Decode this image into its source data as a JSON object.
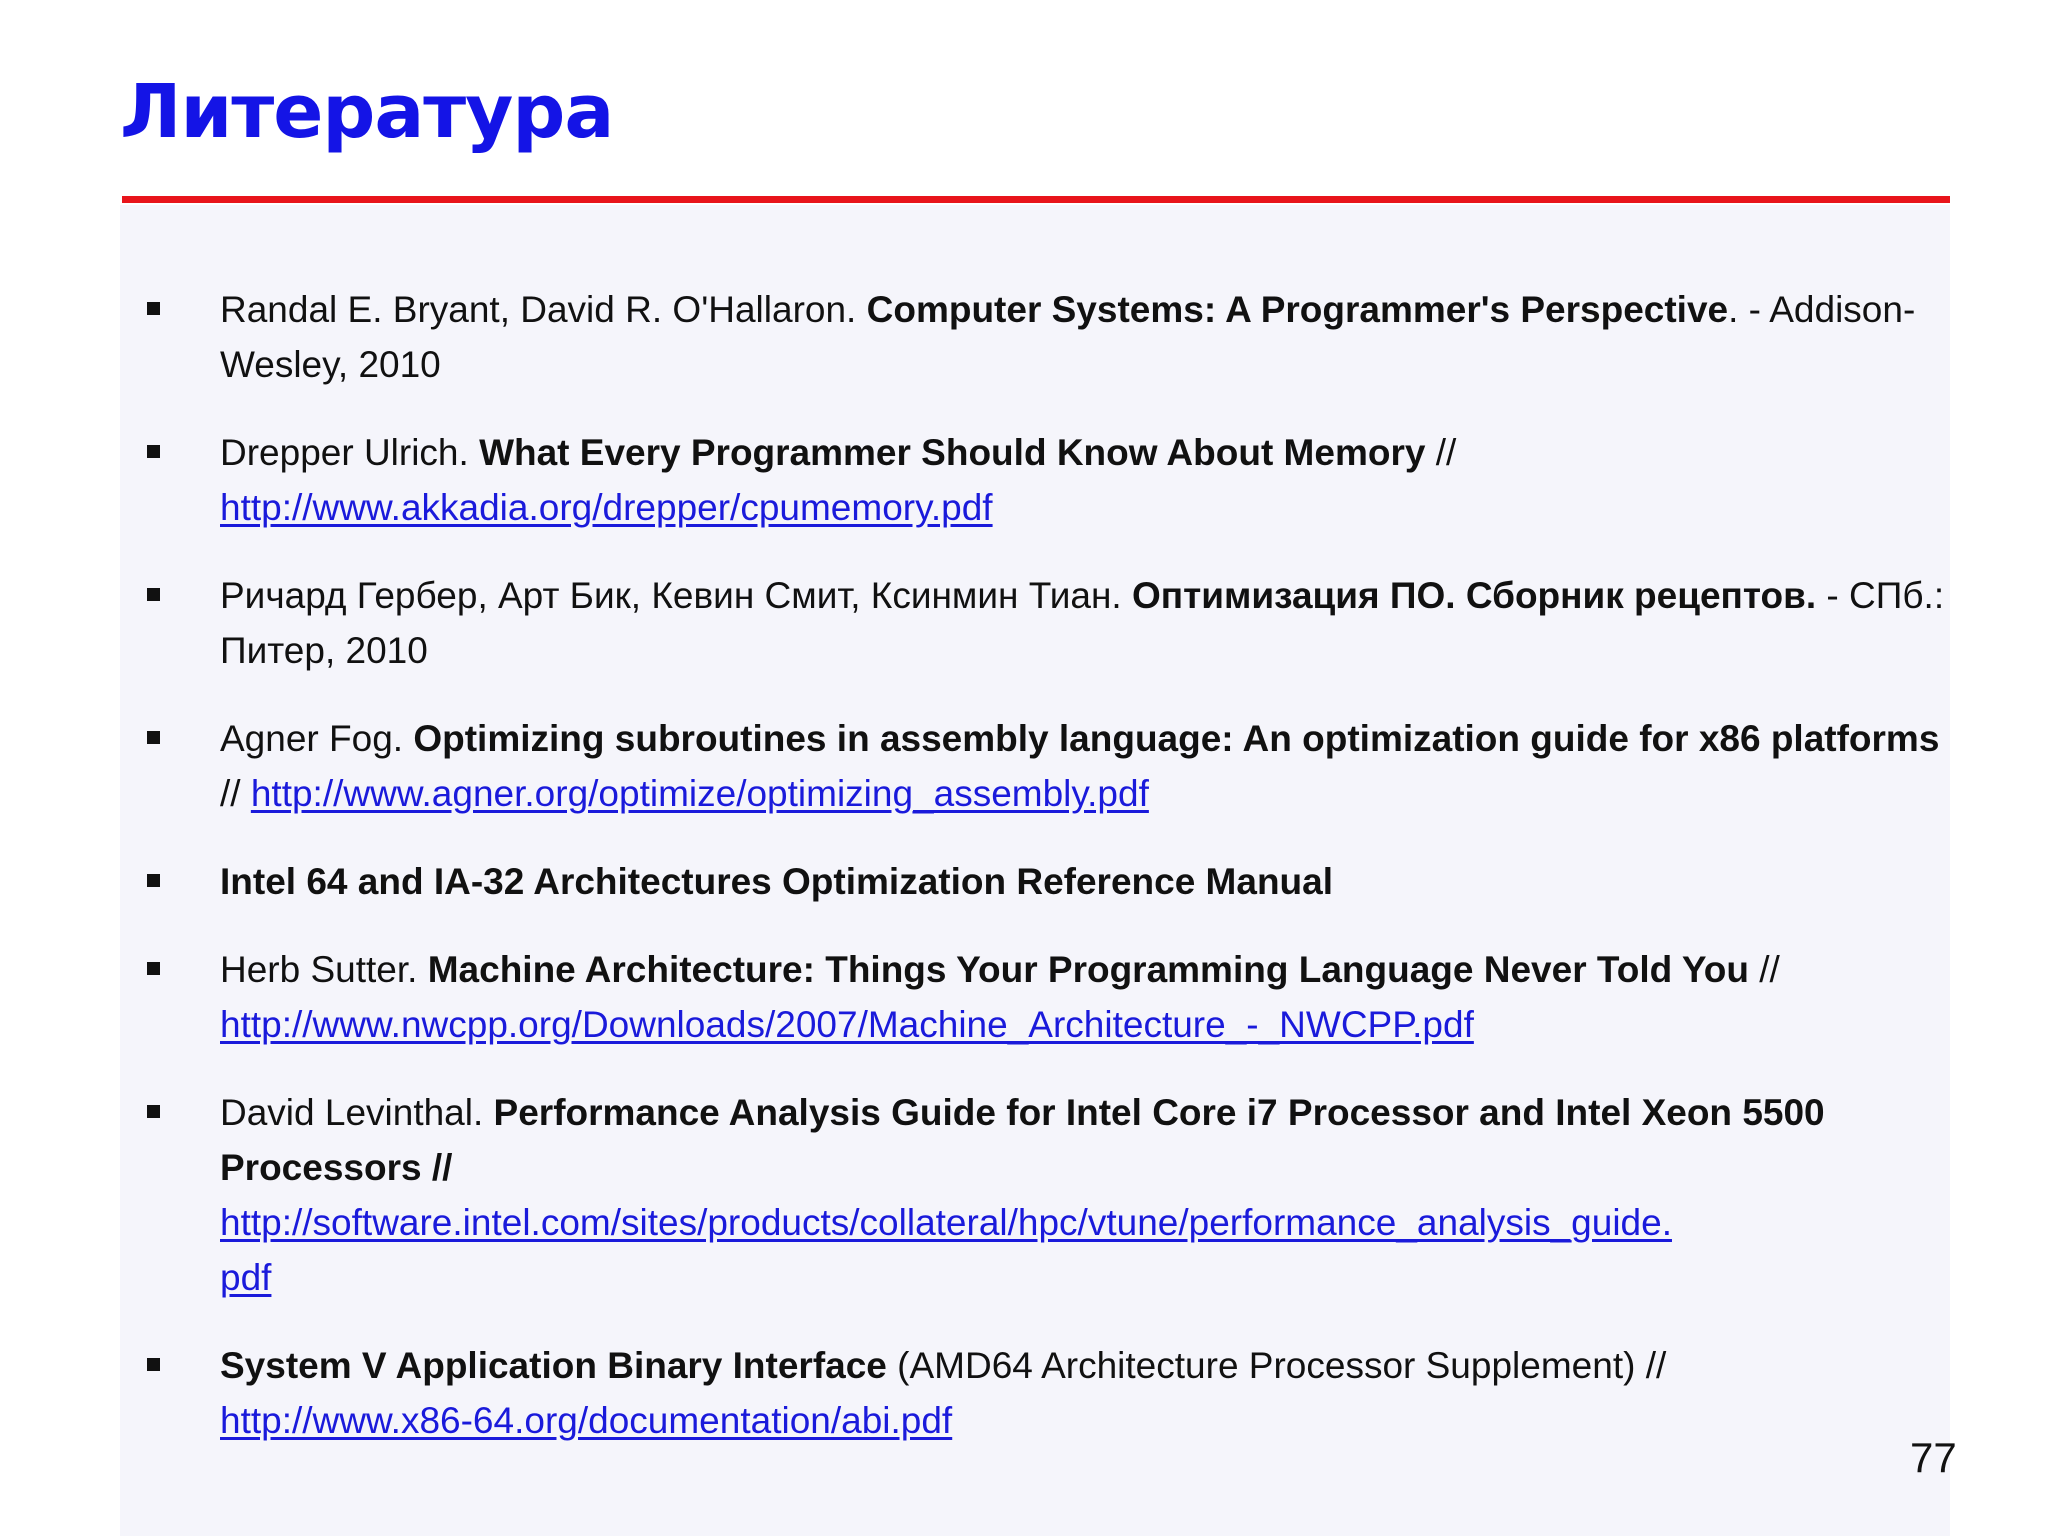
{
  "slide": {
    "title": "Литература",
    "page_number": "77"
  },
  "colors": {
    "title": "#1414e6",
    "rule": "#e8141b",
    "link": "#1a1adb",
    "text": "#111111"
  },
  "references": [
    {
      "authors": "Randal E. Bryant, David R. O'Hallaron. ",
      "title": "Computer Systems: A Programmer's Perspective",
      "tail": ". - Addison-Wesley, 2010"
    },
    {
      "authors": "Drepper Ulrich. ",
      "title": "What Every Programmer Should Know About Memory",
      "sep": " // ",
      "url": "http://www.akkadia.org/drepper/cpumemory.pdf"
    },
    {
      "authors": "Ричард Гербер, Арт Бик, Кевин Смит, Ксинмин Тиан. ",
      "title": "Оптимизация ПО. Сборник рецептов.",
      "tail": " - СПб.: Питер, 2010"
    },
    {
      "authors": "Agner Fog. ",
      "title": "Optimizing subroutines in assembly language: An optimization guide for x86 platforms",
      "sep": " // ",
      "url": "http://www.agner.org/optimize/optimizing_assembly.pdf"
    },
    {
      "title": "Intel 64 and IA-32 Architectures Optimization Reference Manual"
    },
    {
      "authors": "Herb Sutter. ",
      "title": "Machine Architecture: Things Your Programming Language Never Told You",
      "sep": " // ",
      "url": "http://www.nwcpp.org/Downloads/2007/Machine_Architecture_-_NWCPP.pdf"
    },
    {
      "authors": "David Levinthal. ",
      "title": "Performance Analysis Guide for Intel Core i7 Processor and Intel Xeon 5500 Processors //",
      "url_part1": "http://software.intel.com/sites/products/collateral/hpc/vtune/performance_analysis_guide.",
      "url_part2": "pdf"
    },
    {
      "title": "System V Application Binary Interface",
      "tail": " (AMD64 Architecture Processor Supplement) //",
      "url": "http://www.x86-64.org/documentation/abi.pdf"
    }
  ]
}
